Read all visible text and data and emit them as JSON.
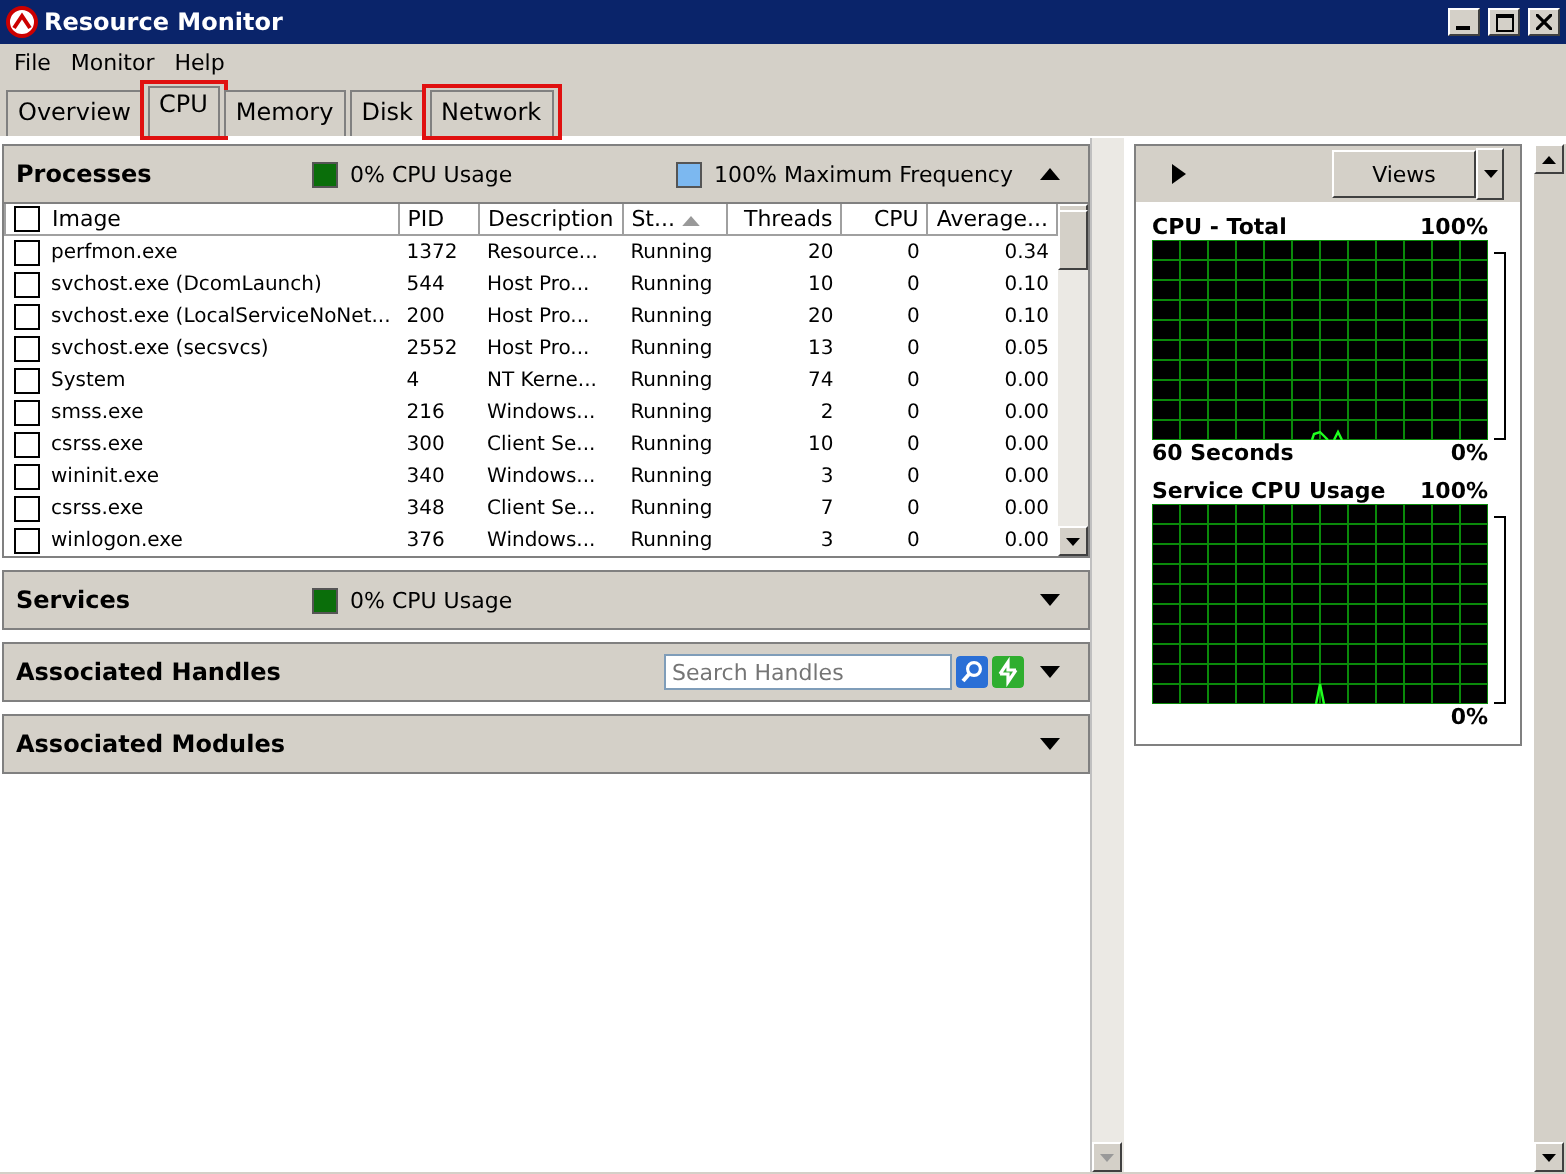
{
  "window": {
    "title": "Resource Monitor"
  },
  "menu": [
    "File",
    "Monitor",
    "Help"
  ],
  "tabs": [
    {
      "label": "Overview",
      "selected": false,
      "highlighted": false
    },
    {
      "label": "CPU",
      "selected": true,
      "highlighted": true
    },
    {
      "label": "Memory",
      "selected": false,
      "highlighted": false
    },
    {
      "label": "Disk",
      "selected": false,
      "highlighted": false
    },
    {
      "label": "Network",
      "selected": false,
      "highlighted": true
    }
  ],
  "processes": {
    "title": "Processes",
    "usage": "0% CPU Usage",
    "frequency": "100% Maximum Frequency",
    "expanded": true,
    "columns": [
      {
        "label": "Image",
        "sorted": false
      },
      {
        "label": "PID",
        "sorted": false
      },
      {
        "label": "Description",
        "sorted": false
      },
      {
        "label": "St...",
        "sorted": true
      },
      {
        "label": "Threads",
        "sorted": false
      },
      {
        "label": "CPU",
        "sorted": false
      },
      {
        "label": "Average...",
        "sorted": false
      }
    ],
    "rows": [
      {
        "checked": false,
        "cells": [
          "perfmon.exe",
          "1372",
          "Resource...",
          "Running",
          "20",
          "0",
          "0.34"
        ]
      },
      {
        "checked": false,
        "cells": [
          "svchost.exe (DcomLaunch)",
          "544",
          "Host Pro...",
          "Running",
          "10",
          "0",
          "0.10"
        ]
      },
      {
        "checked": false,
        "cells": [
          "svchost.exe (LocalServiceNoNet...",
          "200",
          "Host Pro...",
          "Running",
          "20",
          "0",
          "0.10"
        ]
      },
      {
        "checked": false,
        "cells": [
          "svchost.exe (secsvcs)",
          "2552",
          "Host Pro...",
          "Running",
          "13",
          "0",
          "0.05"
        ]
      },
      {
        "checked": false,
        "cells": [
          "System",
          "4",
          "NT Kerne...",
          "Running",
          "74",
          "0",
          "0.00"
        ]
      },
      {
        "checked": false,
        "cells": [
          "smss.exe",
          "216",
          "Windows...",
          "Running",
          "2",
          "0",
          "0.00"
        ]
      },
      {
        "checked": false,
        "cells": [
          "csrss.exe",
          "300",
          "Client Se...",
          "Running",
          "10",
          "0",
          "0.00"
        ]
      },
      {
        "checked": false,
        "cells": [
          "wininit.exe",
          "340",
          "Windows...",
          "Running",
          "3",
          "0",
          "0.00"
        ]
      },
      {
        "checked": false,
        "cells": [
          "csrss.exe",
          "348",
          "Client Se...",
          "Running",
          "7",
          "0",
          "0.00"
        ]
      },
      {
        "checked": false,
        "cells": [
          "winlogon.exe",
          "376",
          "Windows...",
          "Running",
          "3",
          "0",
          "0.00"
        ]
      }
    ]
  },
  "sections": [
    {
      "kind": "usage",
      "title": "Services",
      "usage": "0% CPU Usage",
      "expanded": false
    },
    {
      "kind": "search",
      "title": "Associated Handles",
      "placeholder": "Search Handles",
      "expanded": false
    },
    {
      "kind": "plain",
      "title": "Associated Modules",
      "expanded": false
    }
  ],
  "monitor": {
    "views_button": "Views",
    "graphs": [
      {
        "title": "CPU - Total",
        "max": "100%",
        "footer": "60 Seconds",
        "min": "0%"
      },
      {
        "title": "Service CPU Usage",
        "max": "100%",
        "min": "0%"
      }
    ]
  }
}
